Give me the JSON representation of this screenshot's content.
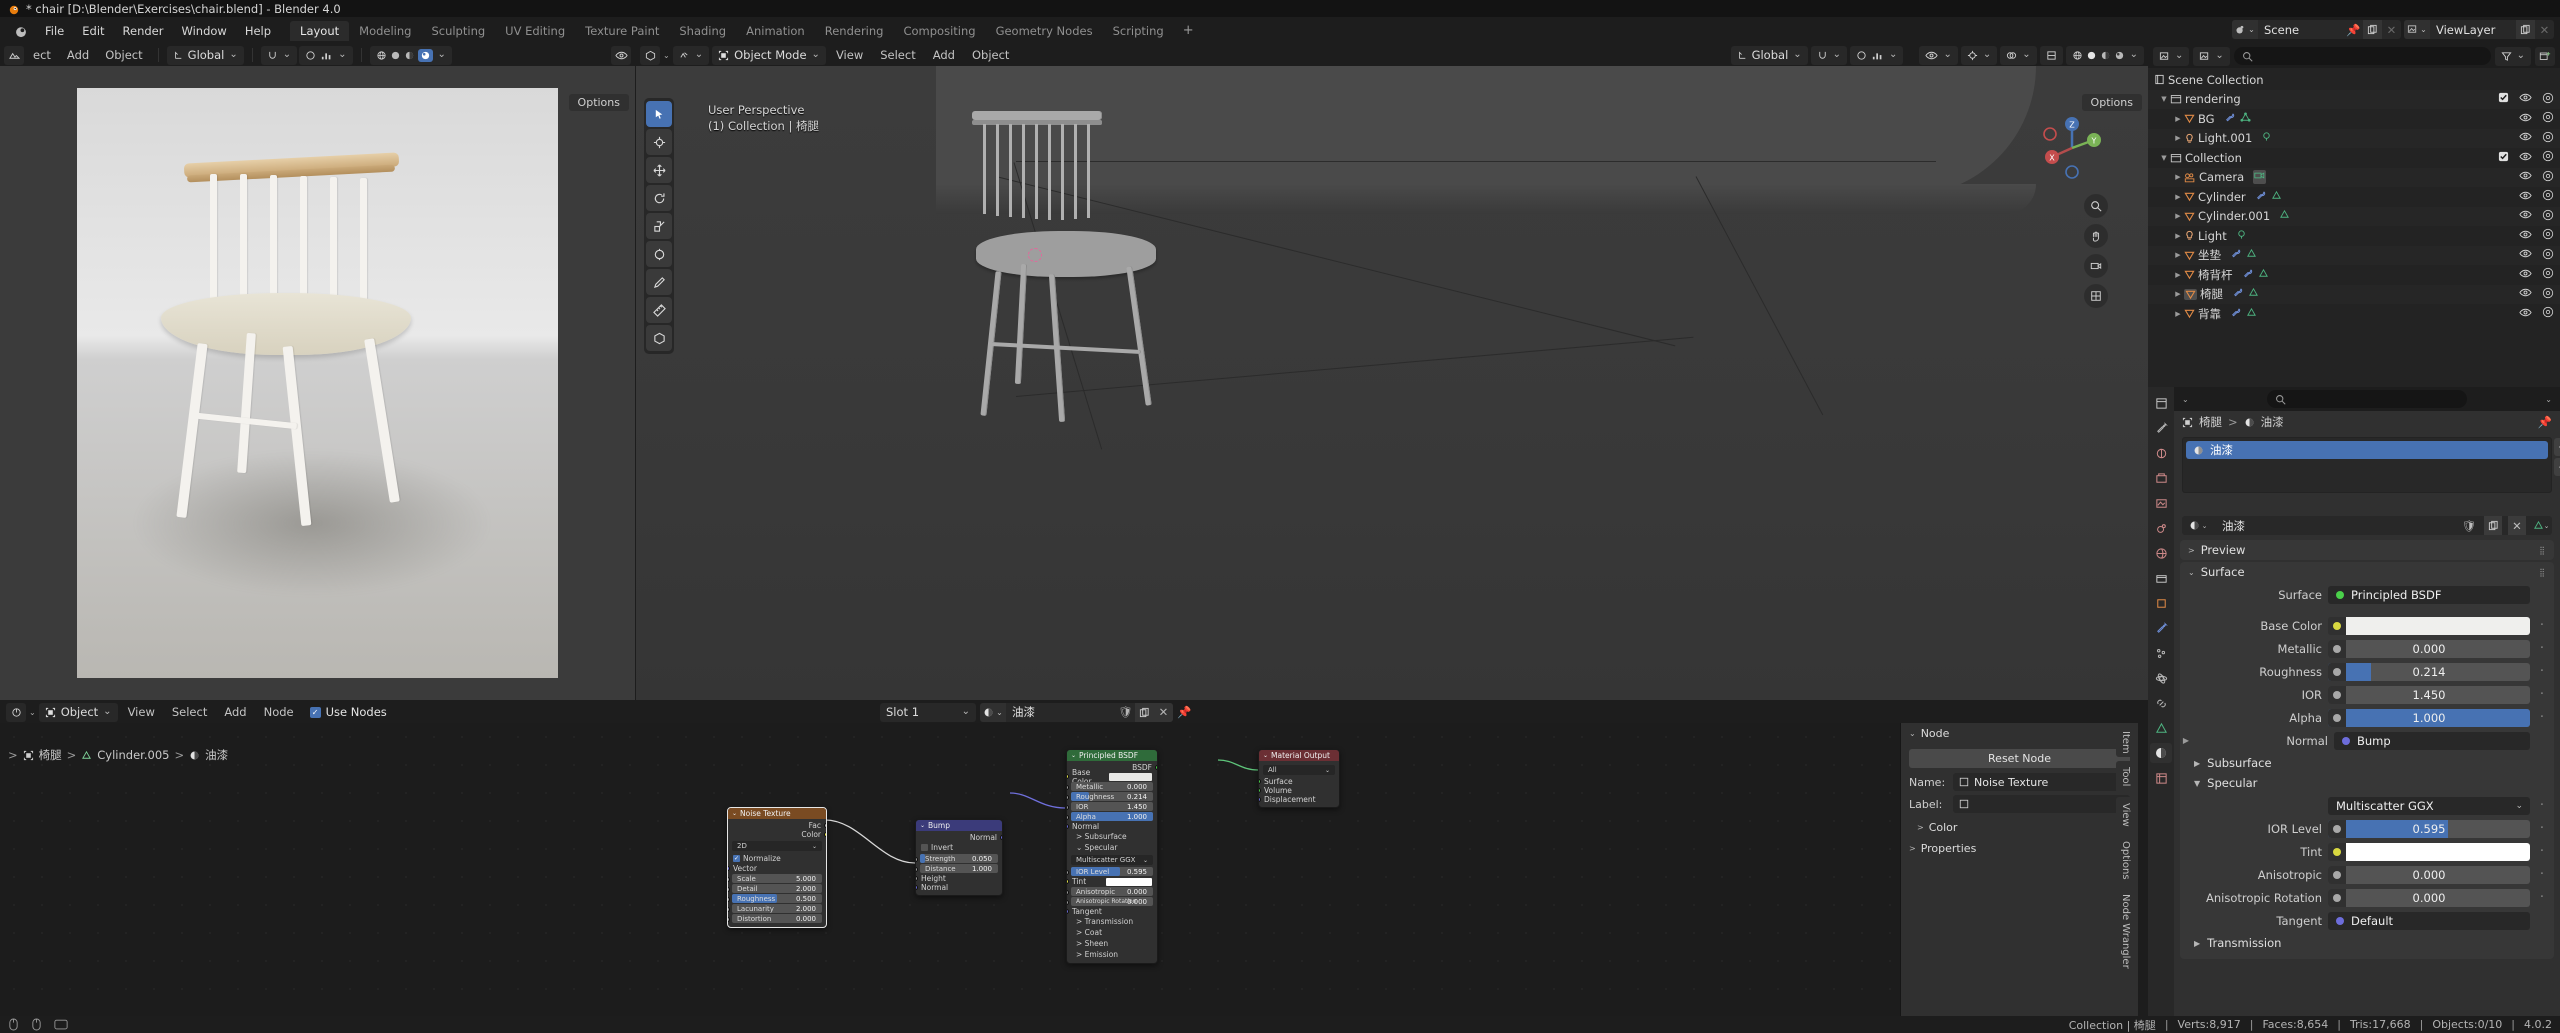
{
  "window": {
    "title": "* chair [D:\\Blender\\Exercises\\chair.blend] - Blender 4.0"
  },
  "topbar": {
    "menus": [
      "File",
      "Edit",
      "Render",
      "Window",
      "Help"
    ],
    "workspaces": [
      "Layout",
      "Modeling",
      "Sculpting",
      "UV Editing",
      "Texture Paint",
      "Shading",
      "Animation",
      "Rendering",
      "Compositing",
      "Geometry Nodes",
      "Scripting"
    ],
    "active_workspace": "Layout",
    "add_workspace": "+",
    "scene": "Scene",
    "view_layer": "ViewLayer"
  },
  "render_view": {
    "menus": [
      "ect",
      "Add",
      "Object"
    ],
    "transform_orientation": "Global",
    "options_label": "Options"
  },
  "viewport3d": {
    "mode": "Object Mode",
    "menus": [
      "View",
      "Select",
      "Add",
      "Object"
    ],
    "transform_orientation": "Global",
    "options_label": "Options",
    "overlay_text_line1": "User Perspective",
    "overlay_text_line2": "(1) Collection | 椅腿",
    "gizmo_axes": [
      "X",
      "Y",
      "Z"
    ]
  },
  "shader_editor": {
    "editor_type": "Object",
    "menus": [
      "View",
      "Select",
      "Add",
      "Node"
    ],
    "use_nodes_label": "Use Nodes",
    "use_nodes_checked": true,
    "slot": "Slot 1",
    "material": "油漆",
    "breadcrumb": [
      "椅腿",
      "Cylinder.005",
      "油漆"
    ],
    "sidebar": {
      "panel_title": "Node",
      "reset_node": "Reset Node",
      "name_label": "Name:",
      "name_value": "Noise Texture",
      "label_label": "Label:",
      "label_value": "",
      "color_label": "Color",
      "properties_label": "Properties",
      "tabs": [
        "Item",
        "Tool",
        "View",
        "Options",
        "Node Wrangler"
      ]
    },
    "nodes": [
      {
        "name": "Noise Texture",
        "header_color": "#7a4b22",
        "outputs": [
          {
            "label": "Fac",
            "color": "gray"
          },
          {
            "label": "Color",
            "color": "yellow"
          }
        ],
        "dimension": "2D",
        "normalize_label": "Normalize",
        "normalize_checked": true,
        "vector_label": "Vector",
        "fields": [
          {
            "label": "Scale",
            "value": "5.000",
            "fill": 0
          },
          {
            "label": "Detail",
            "value": "2.000",
            "fill": 0
          },
          {
            "label": "Roughness",
            "value": "0.500",
            "fill": 0.5
          },
          {
            "label": "Lacunarity",
            "value": "2.000",
            "fill": 0
          },
          {
            "label": "Distortion",
            "value": "0.000",
            "fill": 0
          }
        ]
      },
      {
        "name": "Bump",
        "header_color": "#3b3b7a",
        "outputs": [
          {
            "label": "Normal",
            "color": "purple"
          }
        ],
        "invert_label": "Invert",
        "invert_checked": false,
        "fields": [
          {
            "label": "Strength",
            "value": "0.050",
            "fill": 0.05
          },
          {
            "label": "Distance",
            "value": "1.000",
            "fill": 0
          }
        ],
        "inputs": [
          {
            "label": "Height",
            "color": "gray"
          },
          {
            "label": "Normal",
            "color": "purple"
          }
        ]
      },
      {
        "name": "Principled BSDF",
        "header_color": "#2f6b3a",
        "output_label": "BSDF",
        "base_color_label": "Base Color",
        "base_color_value": "#e8e8e6",
        "fields": [
          {
            "label": "Metallic",
            "value": "0.000",
            "fill": 0
          },
          {
            "label": "Roughness",
            "value": "0.214",
            "fill": 0.214
          },
          {
            "label": "IOR",
            "value": "1.450",
            "fill": 0
          },
          {
            "label": "Alpha",
            "value": "1.000",
            "fill": 1
          }
        ],
        "normal_label": "Normal",
        "subsurface_label": "Subsurface",
        "specular_label": "Specular",
        "distribution": "Multiscatter GGX",
        "ior_level": {
          "label": "IOR Level",
          "value": "0.595",
          "fill": 0.595
        },
        "tint_label": "Tint",
        "tint_value": "#ffffff",
        "aniso": [
          {
            "label": "Anisotropic",
            "value": "0.000",
            "fill": 0
          },
          {
            "label": "Anisotropic Rotation",
            "value": "0.000",
            "fill": 0
          }
        ],
        "tangent_label": "Tangent",
        "collapsed": [
          "Transmission",
          "Coat",
          "Sheen",
          "Emission"
        ]
      },
      {
        "name": "Material Output",
        "header_color": "#6b2f34",
        "target": "All",
        "inputs": [
          {
            "label": "Surface",
            "color": "green"
          },
          {
            "label": "Volume",
            "color": "green"
          },
          {
            "label": "Displacement",
            "color": "purple"
          }
        ]
      }
    ]
  },
  "outliner": {
    "search_placeholder": "",
    "rows": [
      {
        "label": "Scene Collection",
        "indent": 0,
        "icon": "scene-collection-icon",
        "type": "scene",
        "checkbox": false,
        "eye": false,
        "camera": false
      },
      {
        "label": "rendering",
        "indent": 1,
        "icon": "collection-icon",
        "type": "collection",
        "checkbox": true,
        "eye": true,
        "camera": true
      },
      {
        "label": "BG",
        "indent": 2,
        "icon": "mesh-icon",
        "type": "mesh",
        "mods": [
          "wrench",
          "mesh-data"
        ],
        "eye": true,
        "camera": true
      },
      {
        "label": "Light.001",
        "indent": 2,
        "icon": "light-icon",
        "type": "light",
        "mods": [
          "light-data"
        ],
        "eye": true,
        "camera": true
      },
      {
        "label": "Collection",
        "indent": 1,
        "icon": "collection-icon",
        "type": "collection",
        "checkbox": true,
        "eye": true,
        "camera": true
      },
      {
        "label": "Camera",
        "indent": 2,
        "icon": "camera-icon",
        "type": "camera",
        "mods": [
          "camera-data"
        ],
        "eye": true,
        "camera": true
      },
      {
        "label": "Cylinder",
        "indent": 2,
        "icon": "mesh-icon",
        "type": "mesh",
        "mods": [
          "wrench",
          "mesh-data"
        ],
        "eye": true,
        "camera": true
      },
      {
        "label": "Cylinder.001",
        "indent": 2,
        "icon": "mesh-icon",
        "type": "mesh",
        "mods": [
          "mesh-data"
        ],
        "eye": true,
        "camera": true
      },
      {
        "label": "Light",
        "indent": 2,
        "icon": "light-icon",
        "type": "light",
        "mods": [
          "light-data"
        ],
        "eye": true,
        "camera": true
      },
      {
        "label": "坐垫",
        "indent": 2,
        "icon": "mesh-icon",
        "type": "mesh",
        "mods": [
          "wrench",
          "mesh-data"
        ],
        "eye": true,
        "camera": true
      },
      {
        "label": "椅背杆",
        "indent": 2,
        "icon": "mesh-icon",
        "type": "mesh",
        "mods": [
          "wrench",
          "mesh-data"
        ],
        "eye": true,
        "camera": true
      },
      {
        "label": "椅腿",
        "indent": 2,
        "icon": "mesh-icon",
        "type": "mesh",
        "mods": [
          "wrench",
          "mesh-data"
        ],
        "eye": true,
        "camera": true,
        "selected": true
      },
      {
        "label": "背靠",
        "indent": 2,
        "icon": "mesh-icon",
        "type": "mesh",
        "mods": [
          "wrench",
          "mesh-data"
        ],
        "eye": true,
        "camera": true
      }
    ]
  },
  "properties": {
    "breadcrumb": [
      "椅腿",
      "油漆"
    ],
    "material_slot": "油漆",
    "material_name": "油漆",
    "panels": {
      "preview": "Preview",
      "surface": "Surface"
    },
    "surface_shader": {
      "label": "Surface",
      "value": "Principled BSDF"
    },
    "rows": [
      {
        "label": "Base Color",
        "type": "color",
        "value": "#efefed",
        "dot": "#d8d840"
      },
      {
        "label": "Metallic",
        "type": "slider",
        "value": "0.000",
        "fill": 0,
        "dot": "#a8a8a8"
      },
      {
        "label": "Roughness",
        "type": "slider",
        "value": "0.214",
        "fill": 0.214,
        "dot": "#a8a8a8"
      },
      {
        "label": "IOR",
        "type": "slider",
        "value": "1.450",
        "fill": 0,
        "dot": "#a8a8a8"
      },
      {
        "label": "Alpha",
        "type": "slider",
        "value": "1.000",
        "fill": 1,
        "dot": "#a8a8a8"
      },
      {
        "label": "Normal",
        "type": "link",
        "value": "Bump",
        "dot": "#6d6ddb"
      }
    ],
    "subsurface_label": "Subsurface",
    "specular_label": "Specular",
    "distribution": "Multiscatter GGX",
    "specular_rows": [
      {
        "label": "IOR Level",
        "type": "slider",
        "value": "0.595",
        "fill": 0.595,
        "dot": "#a8a8a8"
      },
      {
        "label": "Tint",
        "type": "color",
        "value": "#ffffff",
        "dot": "#d8d840"
      },
      {
        "label": "Anisotropic",
        "type": "slider",
        "value": "0.000",
        "fill": 0,
        "dot": "#a8a8a8"
      },
      {
        "label": "Anisotropic Rotation",
        "type": "slider",
        "value": "0.000",
        "fill": 0,
        "dot": "#a8a8a8"
      },
      {
        "label": "Tangent",
        "type": "link",
        "value": "Default",
        "dot": "#6d6ddb"
      }
    ],
    "transmission_label": "Transmission"
  },
  "statusbar": {
    "left": [
      "Collection | 椅腿"
    ],
    "stats": [
      "Verts:8,917",
      "Faces:8,654",
      "Tris:17,668",
      "Objects:0/10",
      "4.0.2"
    ]
  },
  "colors": {
    "accent_blue": "#4772b3",
    "header_dark": "#1d1d1d",
    "panel": "#303030"
  }
}
